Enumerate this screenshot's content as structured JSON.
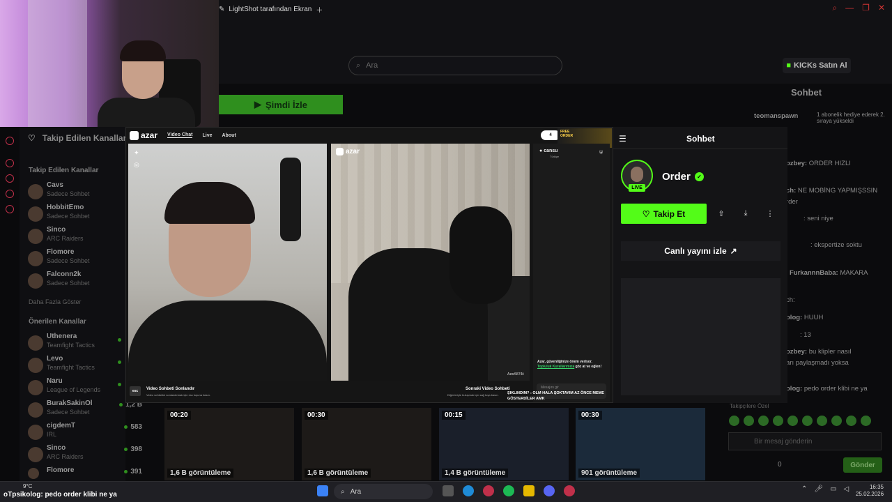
{
  "browser": {
    "tab_title": "LightShot tarafından Ekran",
    "search_placeholder": "Ara",
    "kicks_label": "KICKs Satın Al",
    "watch_now_label": "Şimdi İzle",
    "bg_chat_title": "Sohbet"
  },
  "sidebar": {
    "followed_heading": "Takip Edilen Kanallar",
    "followed_section": "Takip Edilen Kanallar",
    "followed": [
      {
        "name": "Cavs",
        "game": "Sadece Sohbet"
      },
      {
        "name": "HobbitEmo",
        "game": "Sadece Sohbet"
      },
      {
        "name": "Sinco",
        "game": "ARC Raiders"
      },
      {
        "name": "Flomore",
        "game": "Sadece Sohbet"
      },
      {
        "name": "Falconn2k",
        "game": "Sadece Sohbet"
      }
    ],
    "show_more": "Daha Fazla Göster",
    "recommended_section": "Önerilen Kanallar",
    "recommended": [
      {
        "name": "Uthenera",
        "game": "Teamfight Tactics",
        "viewers": ""
      },
      {
        "name": "Levo",
        "game": "Teamfight Tactics",
        "viewers": ""
      },
      {
        "name": "Naru",
        "game": "League of Legends",
        "viewers": ""
      },
      {
        "name": "BurakSakinOl",
        "game": "Sadece Sohbet",
        "viewers": "1,2 B"
      },
      {
        "name": "cigdemT",
        "game": "IRL",
        "viewers": "583"
      },
      {
        "name": "Sinco",
        "game": "ARC Raiders",
        "viewers": "398"
      },
      {
        "name": "Flomore",
        "game": "",
        "viewers": "391"
      }
    ]
  },
  "azar": {
    "logo": "azar",
    "nav": [
      "Video Chat",
      "Live",
      "About"
    ],
    "video_logo": "azar",
    "watermark": "Azar5874ii",
    "partner_name": "cansu",
    "partner_country": "Türkiye",
    "free_badge": "4",
    "free_banner": [
      "FREE",
      "ORDER"
    ],
    "safety_line1": "Azar, güvenliğinize önem veriyor.",
    "safety_link": "Topluluk Kurallarımıza",
    "safety_line2": "göz at ve eğlen!",
    "message_placeholder": "Mesajını gir",
    "esc_key": "esc",
    "end_title": "Video Sohbeti Sonlandır",
    "end_sub": "Video sohbetini sonlandırmak için esc tuşuna basın.",
    "next_title": "Sonraki Video Sohbeti",
    "next_sub": "Diğerleriyle buluşmak için sağ tuşa basın.",
    "overlay_msg": "ŞIKLINDIM? : OLM HALA ŞOKTAYIM AZ ÖNCE MEME GÖSTERDİLER AMK"
  },
  "chat_panel": {
    "title": "Sohbet",
    "streamer": "Order",
    "live_badge": "LIVE",
    "follow_label": "Takip Et",
    "watch_live_label": "Canlı yayını izle"
  },
  "bg_chat": {
    "messages": [
      {
        "user": "teomanspawn",
        "text": ""
      },
      {
        "user": "",
        "text": "1 abonelik hediye ederek 2. sıraya yükseldi"
      },
      {
        "user": "ozbey:",
        "text": "ORDER HIZLI"
      },
      {
        "user": "ch:",
        "text": "NE MOBİNG YAPMIŞSSIN"
      },
      {
        "user": "",
        "text": "rder"
      },
      {
        "user": "",
        "text": ": seni niye"
      },
      {
        "user": "",
        "text": ": ekspertize soktu"
      },
      {
        "user": "FurkannnBaba:",
        "text": "MAKARA"
      },
      {
        "user": "ch:",
        "text": ""
      },
      {
        "user": "olog:",
        "text": "HUUH"
      },
      {
        "user": "",
        "text": ": 13"
      },
      {
        "user": "ozbey:",
        "text": "bu klipler nasıl"
      },
      {
        "user": "",
        "text": "arı paylaşmadı yoksa"
      },
      {
        "user": "olog:",
        "text": "pedo order klibi ne ya"
      }
    ],
    "takipci_label": "Takipçilere Özel",
    "input_placeholder": "Bir mesaj gönderin",
    "count": "0",
    "send_label": "Gönder"
  },
  "thumbnails": [
    {
      "duration": "00:20",
      "views": "1,6 B görüntüleme"
    },
    {
      "duration": "00:30",
      "views": "1,6 B görüntüleme"
    },
    {
      "duration": "00:15",
      "views": "1,4 B görüntüleme"
    },
    {
      "duration": "00:30",
      "views": "901 görüntüleme"
    }
  ],
  "taskbar": {
    "ticker": "oTpsikolog: pedo order klibi ne ya",
    "weather": "9°C",
    "search_label": "Ara",
    "time": "16:35",
    "date": "25.02.2026"
  },
  "colors": {
    "kick_green": "#53fc18",
    "taskbar": "#1f1f24"
  }
}
